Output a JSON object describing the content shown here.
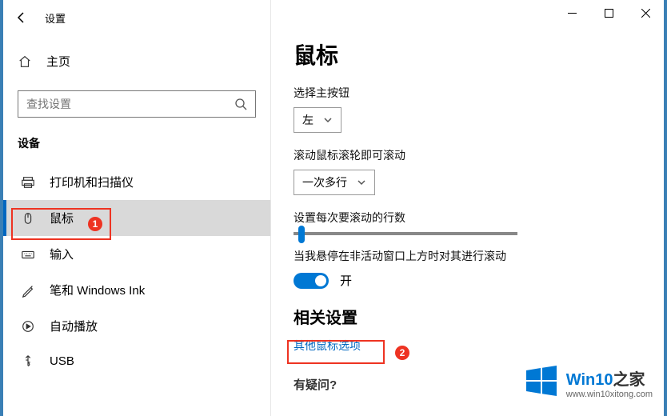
{
  "window": {
    "title": "设置"
  },
  "sidebar": {
    "home": "主页",
    "search_placeholder": "查找设置",
    "category": "设备",
    "items": [
      {
        "label": "打印机和扫描仪",
        "icon": "printer"
      },
      {
        "label": "鼠标",
        "icon": "mouse",
        "active": true
      },
      {
        "label": "输入",
        "icon": "keyboard"
      },
      {
        "label": "笔和 Windows Ink",
        "icon": "pen"
      },
      {
        "label": "自动播放",
        "icon": "autoplay"
      },
      {
        "label": "USB",
        "icon": "usb"
      }
    ]
  },
  "main": {
    "heading": "鼠标",
    "primary_button_label": "选择主按钮",
    "primary_button_value": "左",
    "scroll_wheel_label": "滚动鼠标滚轮即可滚动",
    "scroll_wheel_value": "一次多行",
    "lines_label": "设置每次要滚动的行数",
    "hover_scroll_label": "当我悬停在非活动窗口上方时对其进行滚动",
    "hover_scroll_value": "开",
    "related_heading": "相关设置",
    "related_link": "其他鼠标选项",
    "faint_heading": "有疑问?"
  },
  "annotations": {
    "badge1": "1",
    "badge2": "2"
  },
  "watermark": {
    "brand_pre": "Win10",
    "brand_post": "之家",
    "url": "www.win10xitong.com"
  }
}
